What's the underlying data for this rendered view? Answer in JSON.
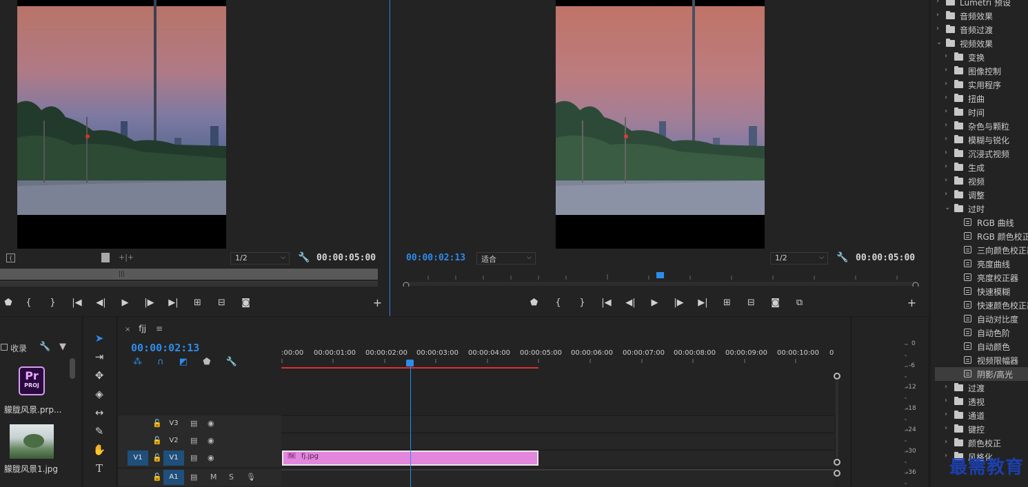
{
  "source_monitor": {
    "scale": "1/2",
    "duration": "00:00:05:00"
  },
  "program_monitor": {
    "current_time": "00:00:02:13",
    "fit": "适合",
    "scale": "1/2",
    "duration": "00:00:05:00"
  },
  "project_panel": {
    "bin_label": "收录",
    "items": [
      {
        "name": "朦胧风景.prp...",
        "type": "project",
        "badge_top": "Pr",
        "badge_bottom": "PROJ"
      },
      {
        "name": "朦胧风景1.jpg",
        "type": "image"
      }
    ]
  },
  "timeline": {
    "sequence_name": "fjj",
    "current_time": "00:00:02:13",
    "ruler_labels": [
      ":00:00",
      "00:00:01:00",
      "00:00:02:00",
      "00:00:03:00",
      "00:00:04:00",
      "00:00:05:00",
      "00:00:06:00",
      "00:00:07:00",
      "00:00:08:00",
      "00:00:09:00",
      "00:00:10:00",
      "0"
    ],
    "tracks": [
      {
        "name": "V3",
        "source": ""
      },
      {
        "name": "V2",
        "source": ""
      },
      {
        "name": "V1",
        "source": "V1"
      },
      {
        "name": "A1",
        "source": "",
        "m": "M",
        "s": "S"
      }
    ],
    "clip": {
      "name": "fj.jpg",
      "fx": "fx"
    }
  },
  "audio_meter": {
    "labels": [
      "0",
      "-6",
      "-12",
      "-18",
      "-24",
      "-30",
      "-36"
    ]
  },
  "effects": {
    "items": [
      {
        "label": "Lumetri 预设",
        "level": 0,
        "kind": "folder",
        "open": false
      },
      {
        "label": "音频效果",
        "level": 0,
        "kind": "folder",
        "open": false
      },
      {
        "label": "音频过渡",
        "level": 0,
        "kind": "folder",
        "open": false
      },
      {
        "label": "视频效果",
        "level": 0,
        "kind": "folder",
        "open": true
      },
      {
        "label": "变换",
        "level": 1,
        "kind": "folder",
        "open": false
      },
      {
        "label": "图像控制",
        "level": 1,
        "kind": "folder",
        "open": false
      },
      {
        "label": "实用程序",
        "level": 1,
        "kind": "folder",
        "open": false
      },
      {
        "label": "扭曲",
        "level": 1,
        "kind": "folder",
        "open": false
      },
      {
        "label": "时间",
        "level": 1,
        "kind": "folder",
        "open": false
      },
      {
        "label": "杂色与颗粒",
        "level": 1,
        "kind": "folder",
        "open": false
      },
      {
        "label": "模糊与锐化",
        "level": 1,
        "kind": "folder",
        "open": false
      },
      {
        "label": "沉浸式视频",
        "level": 1,
        "kind": "folder",
        "open": false
      },
      {
        "label": "生成",
        "level": 1,
        "kind": "folder",
        "open": false
      },
      {
        "label": "视频",
        "level": 1,
        "kind": "folder",
        "open": false
      },
      {
        "label": "调整",
        "level": 1,
        "kind": "folder",
        "open": false
      },
      {
        "label": "过时",
        "level": 1,
        "kind": "folder",
        "open": true
      },
      {
        "label": "RGB 曲线",
        "level": 2,
        "kind": "preset"
      },
      {
        "label": "RGB 颜色校正器",
        "level": 2,
        "kind": "preset"
      },
      {
        "label": "三向颜色校正器",
        "level": 2,
        "kind": "preset"
      },
      {
        "label": "亮度曲线",
        "level": 2,
        "kind": "preset"
      },
      {
        "label": "亮度校正器",
        "level": 2,
        "kind": "preset"
      },
      {
        "label": "快速模糊",
        "level": 2,
        "kind": "preset"
      },
      {
        "label": "快速颜色校正器",
        "level": 2,
        "kind": "preset"
      },
      {
        "label": "自动对比度",
        "level": 2,
        "kind": "preset"
      },
      {
        "label": "自动色阶",
        "level": 2,
        "kind": "preset"
      },
      {
        "label": "自动颜色",
        "level": 2,
        "kind": "preset"
      },
      {
        "label": "视频限幅器",
        "level": 2,
        "kind": "preset"
      },
      {
        "label": "阴影/高光",
        "level": 2,
        "kind": "preset",
        "selected": true
      },
      {
        "label": "过渡",
        "level": 1,
        "kind": "folder",
        "open": false
      },
      {
        "label": "透视",
        "level": 1,
        "kind": "folder",
        "open": false
      },
      {
        "label": "通道",
        "level": 1,
        "kind": "folder",
        "open": false
      },
      {
        "label": "键控",
        "level": 1,
        "kind": "folder",
        "open": false
      },
      {
        "label": "颜色校正",
        "level": 1,
        "kind": "folder",
        "open": false
      },
      {
        "label": "风格化",
        "level": 1,
        "kind": "folder",
        "open": false
      }
    ]
  },
  "watermark": "最需教育",
  "colors": {
    "accent_blue": "#2d8ceb",
    "clip_pink": "#e07fdc",
    "render_bar_red": "#e03030",
    "watermark_blue": "#1c3fae"
  }
}
